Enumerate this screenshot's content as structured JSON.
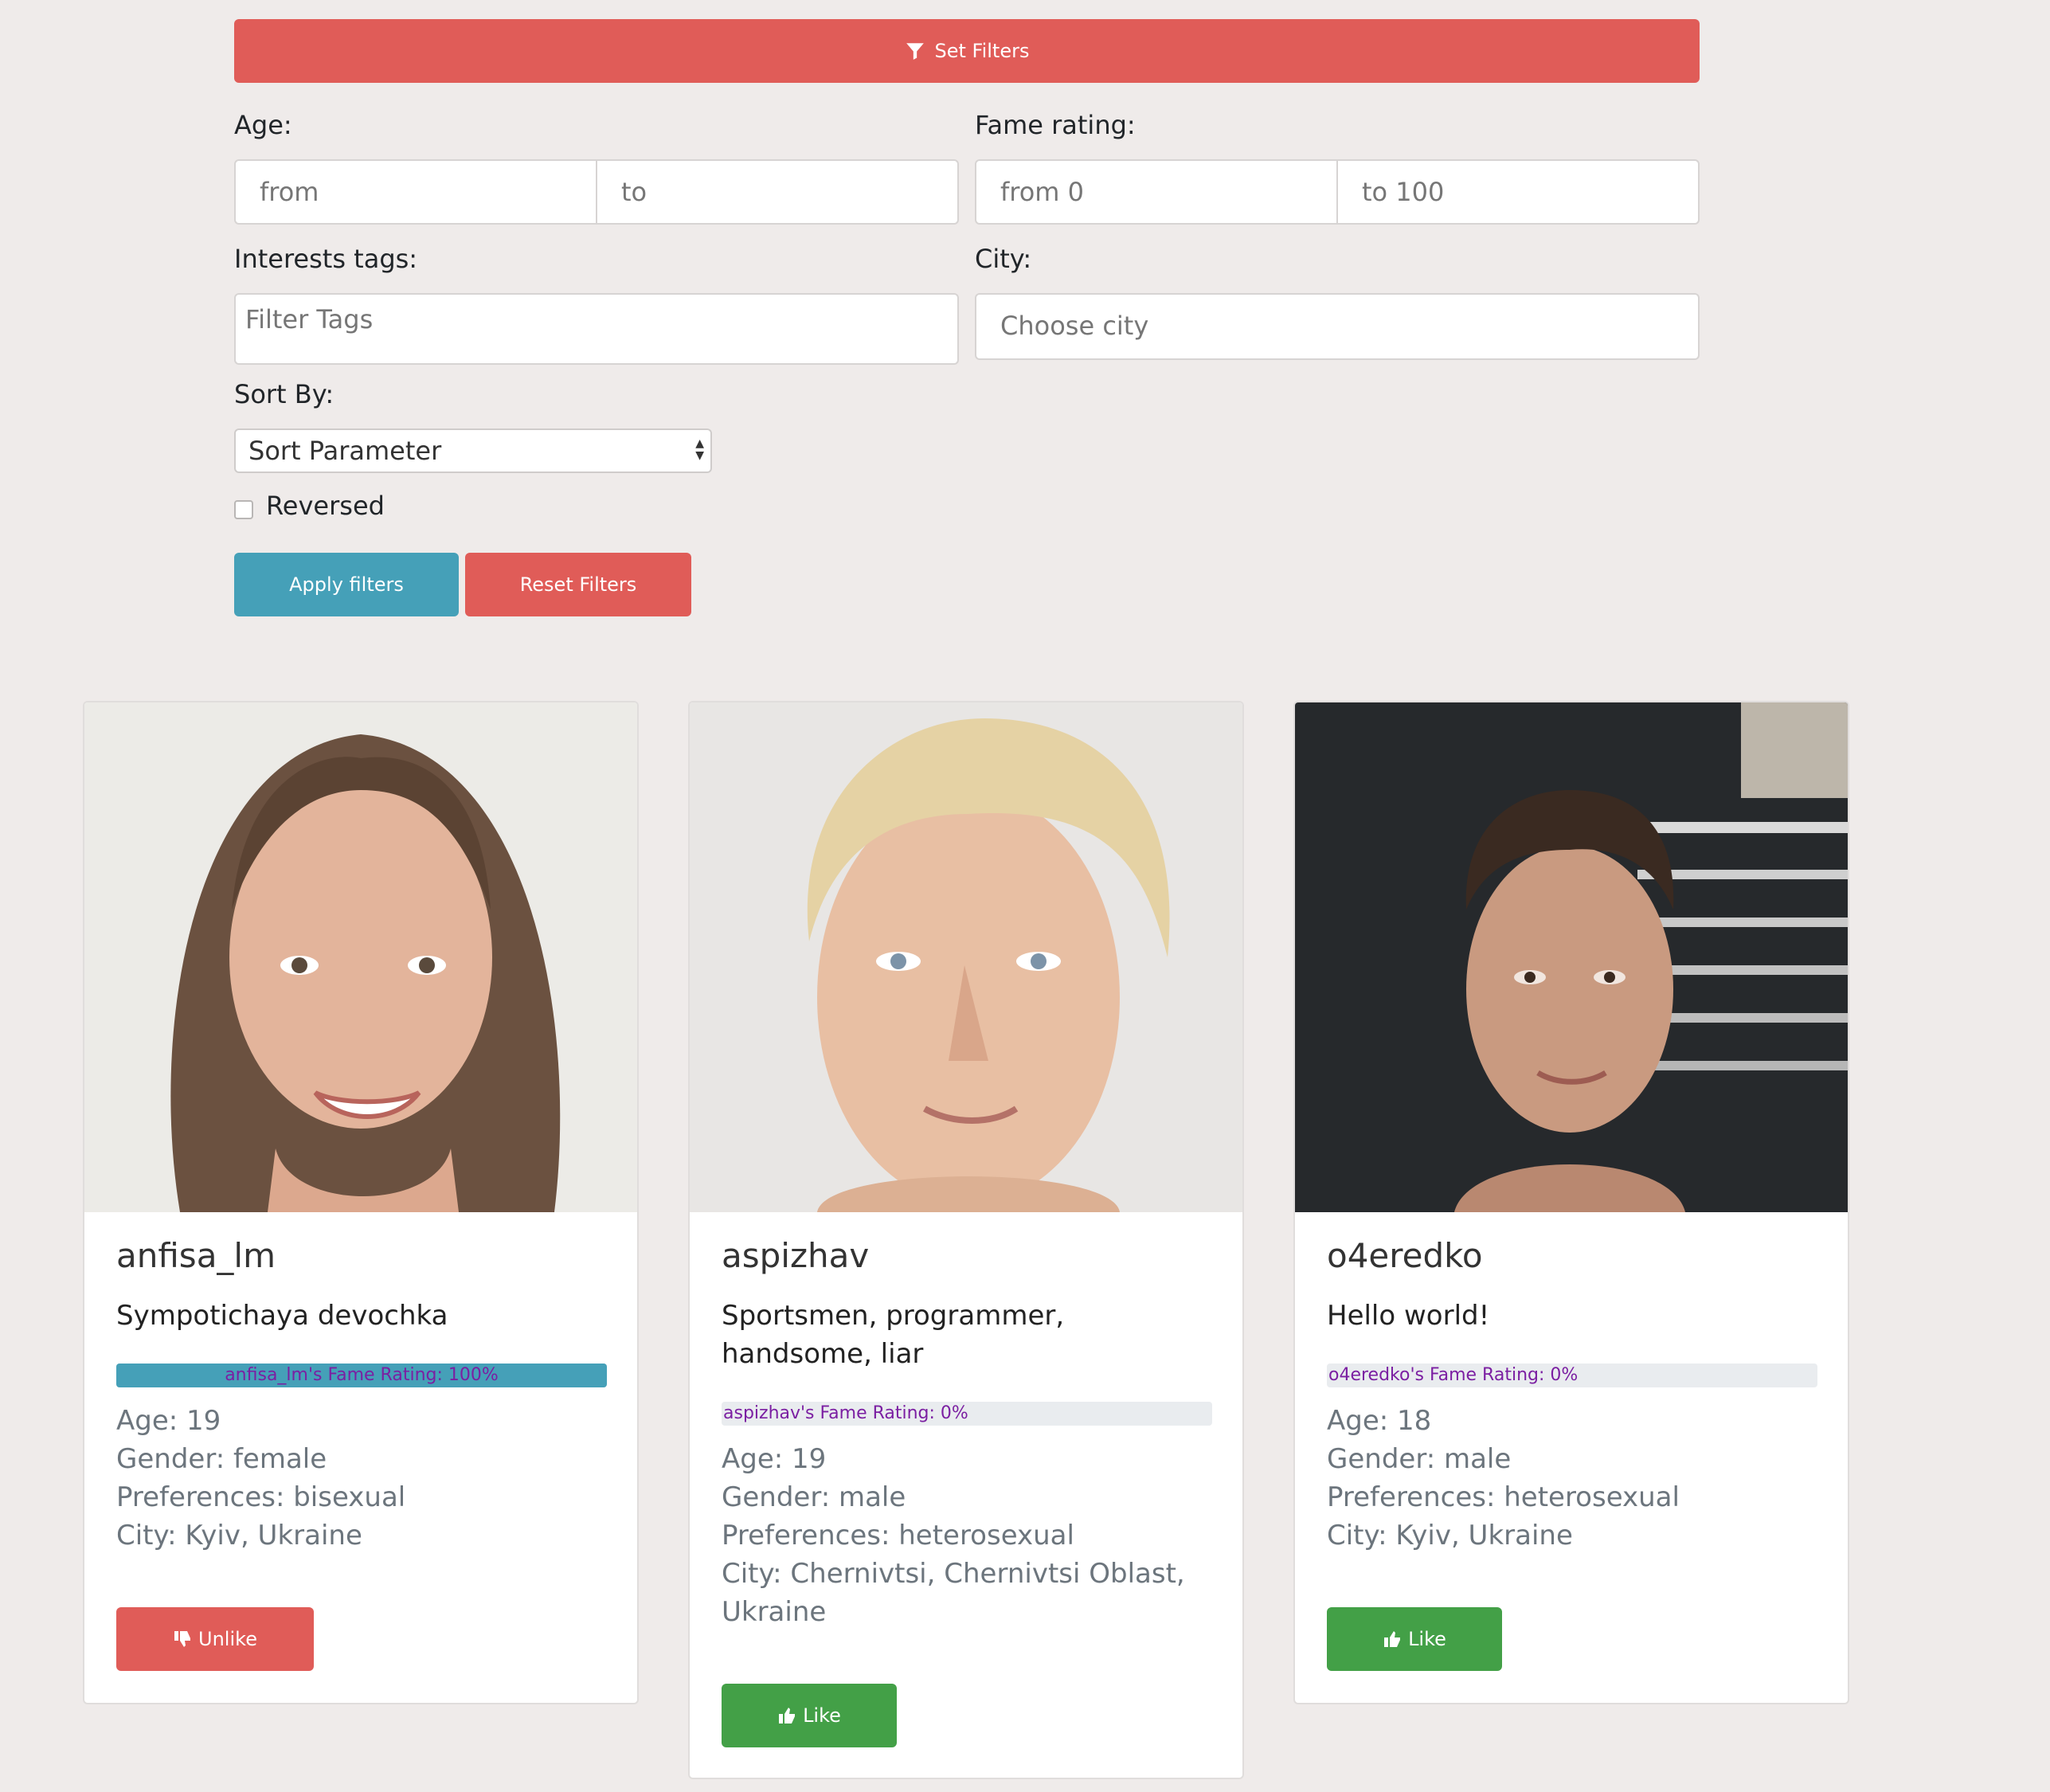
{
  "filters": {
    "set_filters_label": "Set Filters",
    "age_label": "Age:",
    "age_from_placeholder": "from",
    "age_to_placeholder": "to",
    "fame_label": "Fame rating:",
    "fame_from_placeholder": "from 0",
    "fame_to_placeholder": "to 100",
    "tags_label": "Interests tags:",
    "tags_placeholder": "Filter Tags",
    "city_label": "City:",
    "city_placeholder": "Choose city",
    "sort_label": "Sort By:",
    "sort_selected": "Sort Parameter",
    "reversed_label": "Reversed",
    "apply_label": "Apply filters",
    "reset_label": "Reset Filters"
  },
  "colors": {
    "primary_red": "#e05c58",
    "info_blue": "#45a0b8",
    "success_green": "#43a047"
  },
  "cards": [
    {
      "username": "anfisa_lm",
      "bio": "Sympotichaya devochka",
      "fame_text": "anfisa_lm's Fame Rating: 100%",
      "fame_percent": 100,
      "age": "Age: 19",
      "gender": "Gender: female",
      "preferences": "Preferences: bisexual",
      "city": "City: Kyiv, Ukraine",
      "action_label": "Unlike",
      "action_icon": "thumbs-down-icon"
    },
    {
      "username": "aspizhav",
      "bio": "Sportsmen, programmer, handsome, liar",
      "fame_text": "aspizhav's Fame Rating: 0%",
      "fame_percent": 0,
      "age": "Age: 19",
      "gender": "Gender: male",
      "preferences": "Preferences: heterosexual",
      "city": "City: Chernivtsi, Chernivtsi Oblast, Ukraine",
      "action_label": "Like",
      "action_icon": "thumbs-up-icon"
    },
    {
      "username": "o4eredko",
      "bio": "Hello world!",
      "fame_text": "o4eredko's Fame Rating: 0%",
      "fame_percent": 0,
      "age": "Age: 18",
      "gender": "Gender: male",
      "preferences": "Preferences: heterosexual",
      "city": "City: Kyiv, Ukraine",
      "action_label": "Like",
      "action_icon": "thumbs-up-icon"
    }
  ]
}
